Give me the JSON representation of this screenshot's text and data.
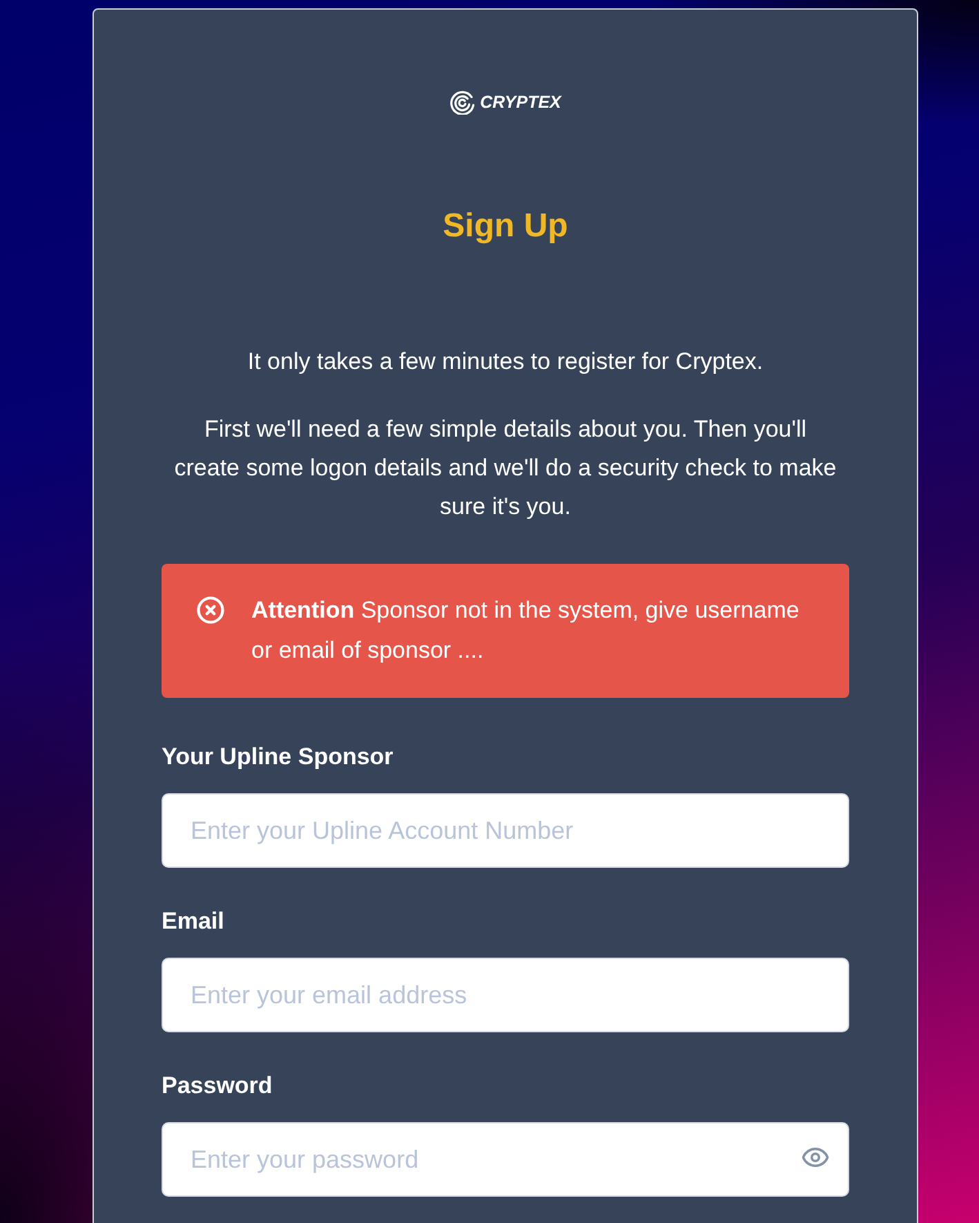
{
  "logo": {
    "text": "CRYPTEX"
  },
  "title": "Sign Up",
  "intro": [
    "It only takes a few minutes to register for Cryptex.",
    "First we'll need a few simple details about you. Then you'll create some logon details and we'll do a security check to make sure it's you."
  ],
  "alert": {
    "kind": "error",
    "message": "**Attention** Sponsor not in the system, give username or email of sponsor ...."
  },
  "fields": [
    {
      "kind": "text",
      "label": "Your Upline Sponsor",
      "placeholder": "Enter your Upline Account Number"
    },
    {
      "kind": "email",
      "label": "Email",
      "placeholder": "Enter your email address"
    },
    {
      "kind": "password",
      "label": "Password",
      "placeholder": "Enter your password"
    }
  ]
}
